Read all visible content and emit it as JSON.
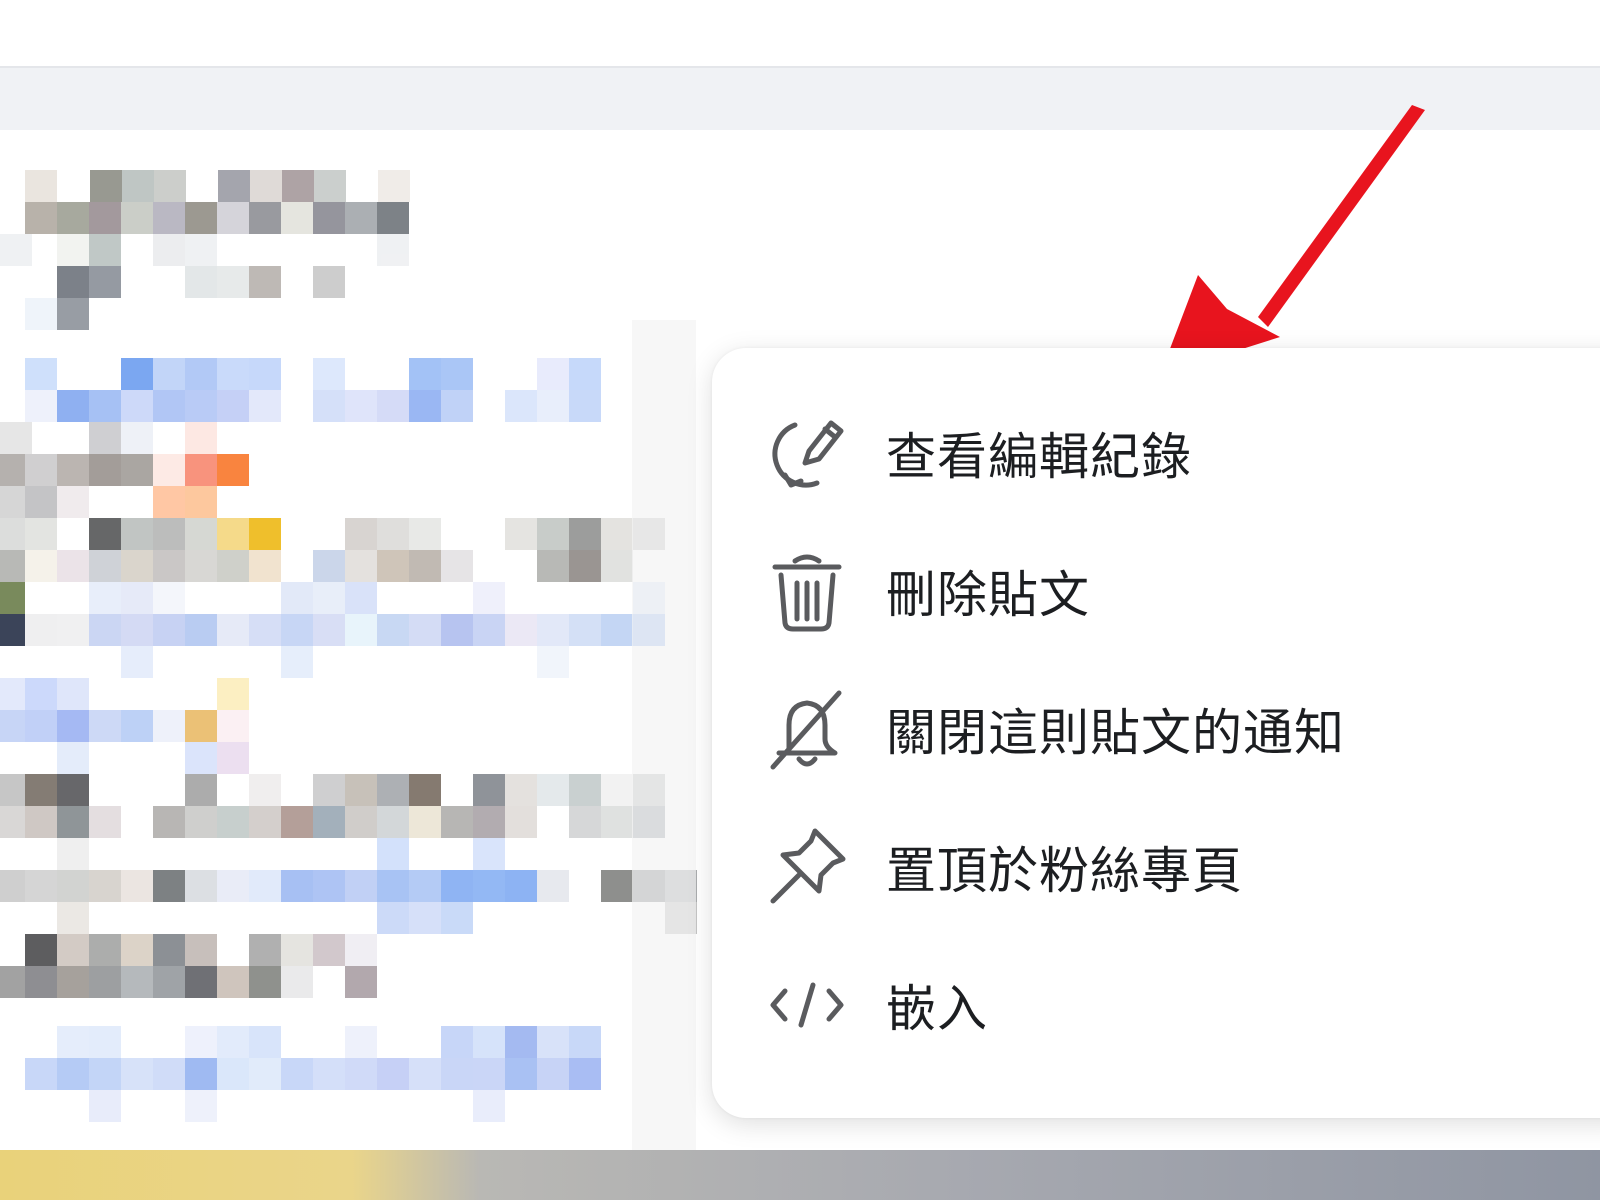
{
  "menu": {
    "items": [
      {
        "label": "查看編輯紀錄",
        "icon": "edit-history-icon"
      },
      {
        "label": "刪除貼文",
        "icon": "trash-icon"
      },
      {
        "label": "關閉這則貼文的通知",
        "icon": "bell-off-icon"
      },
      {
        "label": "置頂於粉絲專頁",
        "icon": "pin-icon"
      },
      {
        "label": "嵌入",
        "icon": "code-icon"
      }
    ]
  },
  "colors": {
    "menu_text": "#1c1e21",
    "icon": "#65676b",
    "arrow": "#e8141e",
    "page_bg": "#f0f2f5"
  }
}
